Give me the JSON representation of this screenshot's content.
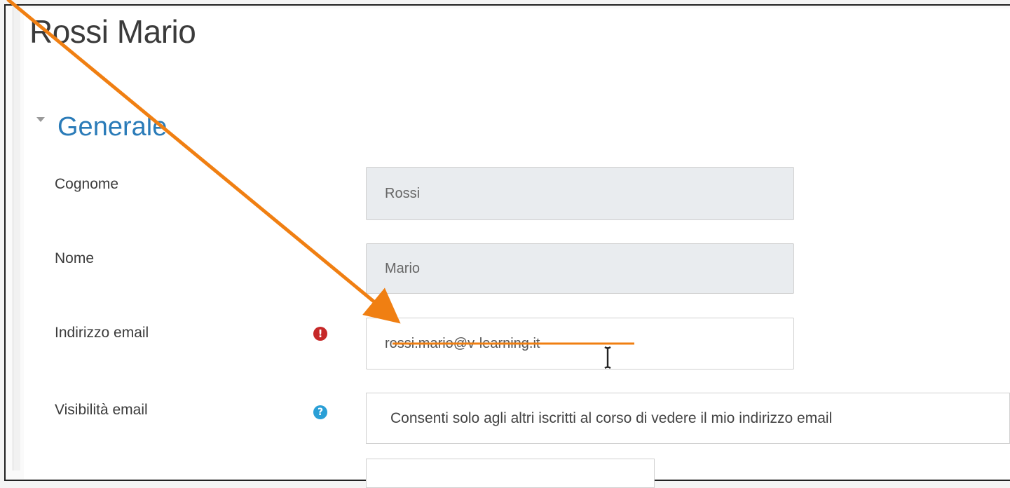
{
  "page": {
    "title": "Rossi Mario"
  },
  "section": {
    "title": "Generale"
  },
  "form": {
    "surname": {
      "label": "Cognome",
      "value": "Rossi"
    },
    "name": {
      "label": "Nome",
      "value": "Mario"
    },
    "email": {
      "label": "Indirizzo email",
      "value": "rossi.mario@v-learning.it",
      "status_icon": "error-icon"
    },
    "email_visibility": {
      "label": "Visibilità email",
      "value": "Consenti solo agli altri iscritti al corso di vedere il mio indirizzo email",
      "status_icon": "help-icon"
    }
  },
  "annotation": {
    "color": "#f07f12"
  }
}
